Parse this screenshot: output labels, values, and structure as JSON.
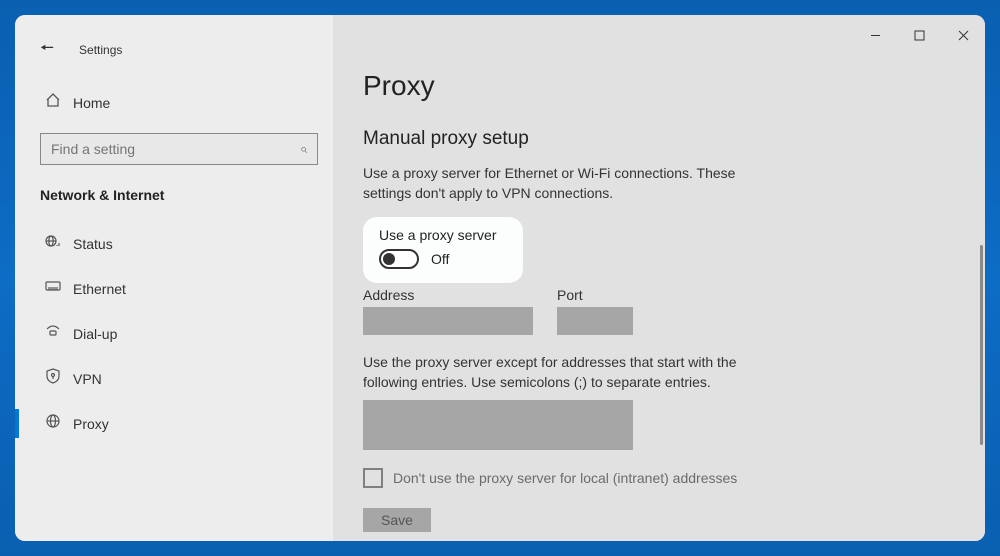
{
  "header": {
    "settings_label": "Settings",
    "home_label": "Home",
    "search_placeholder": "Find a setting"
  },
  "sidebar": {
    "category": "Network & Internet",
    "items": [
      {
        "label": "Status",
        "selected": false
      },
      {
        "label": "Ethernet",
        "selected": false
      },
      {
        "label": "Dial-up",
        "selected": false
      },
      {
        "label": "VPN",
        "selected": false
      },
      {
        "label": "Proxy",
        "selected": true
      }
    ]
  },
  "main": {
    "title": "Proxy",
    "section": "Manual proxy setup",
    "description": "Use a proxy server for Ethernet or Wi-Fi connections. These settings don't apply to VPN connections.",
    "toggle_label": "Use a proxy server",
    "toggle_state": "Off",
    "address_label": "Address",
    "port_label": "Port",
    "bypass_desc": "Use the proxy server except for addresses that start with the following entries. Use semicolons (;) to separate entries.",
    "checkbox_label": "Don't use the proxy server for local (intranet) addresses",
    "save_label": "Save"
  }
}
